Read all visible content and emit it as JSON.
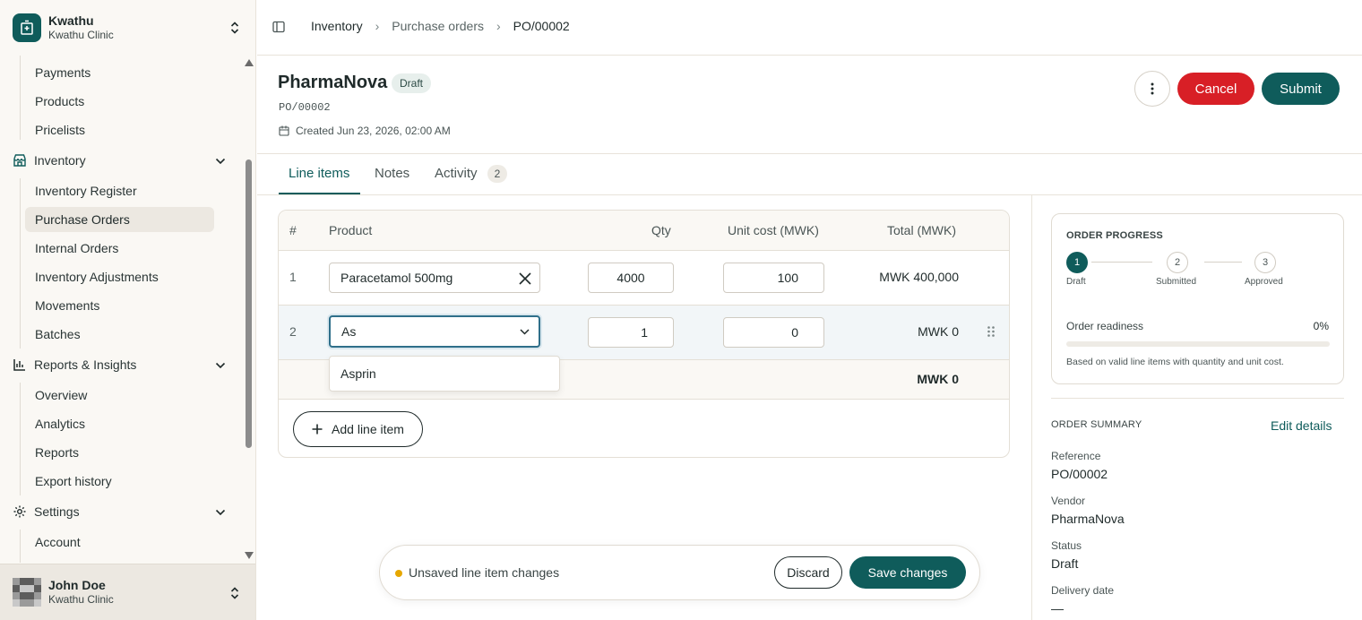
{
  "org": {
    "name": "Kwathu",
    "subtitle": "Kwathu Clinic"
  },
  "nav": {
    "items_top": [
      "Payments",
      "Products",
      "Pricelists"
    ],
    "inventory": {
      "label": "Inventory",
      "items": [
        "Inventory Register",
        "Purchase Orders",
        "Internal Orders",
        "Inventory Adjustments",
        "Movements",
        "Batches"
      ],
      "active": "Purchase Orders"
    },
    "reports": {
      "label": "Reports & Insights",
      "items": [
        "Overview",
        "Analytics",
        "Reports",
        "Export history"
      ]
    },
    "settings": {
      "label": "Settings",
      "items": [
        "Account"
      ]
    }
  },
  "user": {
    "name": "John Doe",
    "org": "Kwathu Clinic"
  },
  "breadcrumb": [
    "Inventory",
    "Purchase orders",
    "PO/00002"
  ],
  "header": {
    "vendor": "PharmaNova",
    "status": "Draft",
    "reference": "PO/00002",
    "created": "Created Jun 23, 2026, 02:00 AM",
    "cancel_label": "Cancel",
    "submit_label": "Submit"
  },
  "tabs": [
    {
      "label": "Line items"
    },
    {
      "label": "Notes"
    },
    {
      "label": "Activity",
      "count": "2"
    }
  ],
  "table": {
    "headers": [
      "#",
      "Product",
      "Qty",
      "Unit cost (MWK)",
      "Total (MWK)"
    ],
    "rows": [
      {
        "num": "1",
        "product": "Paracetamol 500mg",
        "qty": "4000",
        "unit_cost": "100",
        "total": "MWK 400,000"
      },
      {
        "num": "2",
        "product": "As",
        "qty": "1",
        "unit_cost": "0",
        "total": "MWK 0"
      }
    ],
    "grand_total": "MWK 0",
    "dropdown_option": "Asprin",
    "add_line_label": "Add line item"
  },
  "progress": {
    "title": "ORDER PROGRESS",
    "steps": [
      {
        "num": "1",
        "label": "Draft"
      },
      {
        "num": "2",
        "label": "Submitted"
      },
      {
        "num": "3",
        "label": "Approved"
      }
    ],
    "readiness_label": "Order readiness",
    "readiness_value": "0%",
    "readiness_fraction": 0,
    "note": "Based on valid line items with quantity and unit cost."
  },
  "summary": {
    "title": "ORDER SUMMARY",
    "edit_label": "Edit details",
    "fields": [
      {
        "label": "Reference",
        "value": "PO/00002"
      },
      {
        "label": "Vendor",
        "value": "PharmaNova"
      },
      {
        "label": "Status",
        "value": "Draft"
      },
      {
        "label": "Delivery date",
        "value": "—"
      }
    ]
  },
  "unsaved": {
    "message": "Unsaved line item changes",
    "discard_label": "Discard",
    "save_label": "Save changes"
  },
  "colors": {
    "brand": "#0f5c5b",
    "danger": "#d81f26",
    "warning": "#e6a700"
  }
}
